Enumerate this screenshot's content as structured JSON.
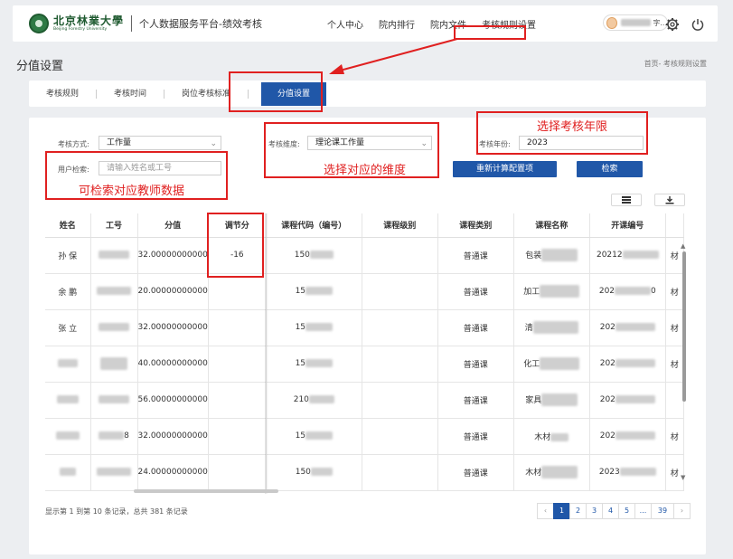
{
  "header": {
    "logo_cn": "北京林業大學",
    "logo_en": "Beijing Forestry University",
    "platform_title": "个人数据服务平台-绩效考核",
    "nav": [
      {
        "label": "个人中心"
      },
      {
        "label": "院内排行"
      },
      {
        "label": "院内文件"
      },
      {
        "label": "考核规则设置"
      }
    ],
    "user_suffix": "字..."
  },
  "page": {
    "title": "分值设置",
    "breadcrumb": "首页- 考核规则设置"
  },
  "tabs": [
    {
      "label": "考核规则"
    },
    {
      "label": "考核时间"
    },
    {
      "label": "岗位考核标准"
    },
    {
      "label": "分值设置"
    }
  ],
  "filters": {
    "method_label": "考核方式:",
    "method_value": "工作量",
    "dimension_label": "考核维度:",
    "dimension_value": "理论课工作量",
    "year_label": "考核年份:",
    "year_value": "2023",
    "user_label": "用户检索:",
    "user_placeholder": "请输入姓名或工号",
    "recompute_label": "重新计算配置项",
    "search_label": "检索"
  },
  "annotations": {
    "year": "选择考核年限",
    "dimension": "选择对应的维度",
    "search": "可检索对应教师数据"
  },
  "table": {
    "columns": [
      "姓名",
      "工号",
      "分值",
      "调节分",
      "课程代码（编号）",
      "课程级别",
      "课程类别",
      "课程名称",
      "开课编号"
    ],
    "rows": [
      {
        "name": "孙 保",
        "score": "32.00000000000",
        "adjust": "-16",
        "code": "150",
        "category": "普通课",
        "course": "包装",
        "open": "20212",
        "extra": "材"
      },
      {
        "name": "余 鹏",
        "score": "20.00000000000",
        "adjust": "",
        "code": "15",
        "category": "普通课",
        "course": "加工",
        "open": "202",
        "open_tail": "0",
        "extra": "材"
      },
      {
        "name": "张 立",
        "score": "32.00000000000",
        "adjust": "",
        "code": "15",
        "category": "普通课",
        "course": "清",
        "open": "202",
        "extra": "材"
      },
      {
        "name": "",
        "score": "40.00000000000",
        "adjust": "",
        "code": "15",
        "category": "普通课",
        "course": "化工",
        "open": "202",
        "extra": "材"
      },
      {
        "name": "",
        "score": "56.00000000000",
        "adjust": "",
        "code": "210",
        "category": "普通课",
        "course": "家具",
        "open": "202",
        "extra": ""
      },
      {
        "name": "",
        "id_tail": "8",
        "score": "32.00000000000",
        "adjust": "",
        "code": "15",
        "category": "普通课",
        "course": "木材",
        "open": "202",
        "extra": "材"
      },
      {
        "name": "",
        "score": "24.00000000000",
        "adjust": "",
        "code": "150",
        "category": "普通课",
        "course": "木材",
        "open": "2023",
        "extra": "材"
      }
    ]
  },
  "footer": {
    "info": "显示第 1 到第 10 条记录，总共 381 条记录",
    "pages": [
      "‹",
      "1",
      "2",
      "3",
      "4",
      "5",
      "...",
      "39",
      "›"
    ],
    "active_page": "1"
  }
}
